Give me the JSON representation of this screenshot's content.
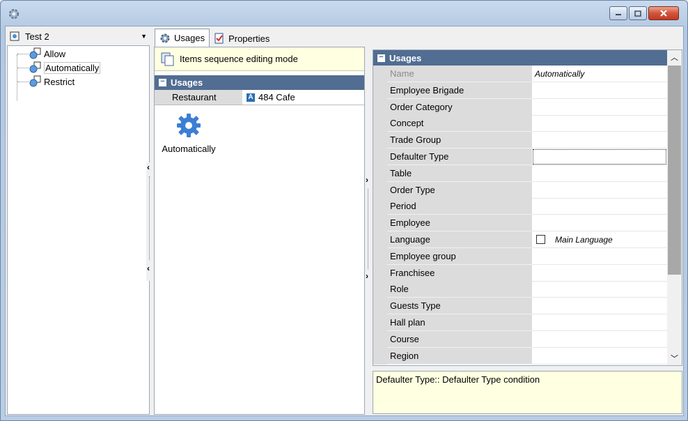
{
  "window": {
    "icons": {
      "app": "gear-icon",
      "minimize": "minimize-icon",
      "maximize": "maximize-icon",
      "close": "close-icon"
    }
  },
  "left": {
    "combo_value": "Test 2",
    "tree_items": [
      {
        "label": "Allow"
      },
      {
        "label": "Automatically"
      },
      {
        "label": "Restrict"
      }
    ]
  },
  "tabs": [
    {
      "label": "Usages",
      "icon": "gear-icon",
      "active": true
    },
    {
      "label": "Properties",
      "icon": "properties-icon",
      "active": false
    }
  ],
  "middle": {
    "sequence_button": "Items sequence editing mode",
    "section_title": "Usages",
    "row": {
      "key": "Restaurant",
      "value": "484 Cafe",
      "badge": "A"
    },
    "usage_item": {
      "label": "Automatically",
      "icon": "gear-icon"
    }
  },
  "grid": {
    "section_title": "Usages",
    "rows": [
      {
        "key": "Name",
        "value": "Automatically"
      },
      {
        "key": "Employee Brigade",
        "value": ""
      },
      {
        "key": "Order Category",
        "value": ""
      },
      {
        "key": "Concept",
        "value": ""
      },
      {
        "key": "Trade Group",
        "value": ""
      },
      {
        "key": "Defaulter Type",
        "value": ""
      },
      {
        "key": "Table",
        "value": ""
      },
      {
        "key": "Order Type",
        "value": ""
      },
      {
        "key": "Period",
        "value": ""
      },
      {
        "key": "Employee",
        "value": ""
      },
      {
        "key": "Language",
        "value": "Main Language"
      },
      {
        "key": "Employee group",
        "value": ""
      },
      {
        "key": "Franchisee",
        "value": ""
      },
      {
        "key": "Role",
        "value": ""
      },
      {
        "key": "Guests Type",
        "value": ""
      },
      {
        "key": "Hall plan",
        "value": ""
      },
      {
        "key": "Course",
        "value": ""
      },
      {
        "key": "Region",
        "value": ""
      }
    ]
  },
  "description": "Defaulter Type:: Defaulter Type condition"
}
